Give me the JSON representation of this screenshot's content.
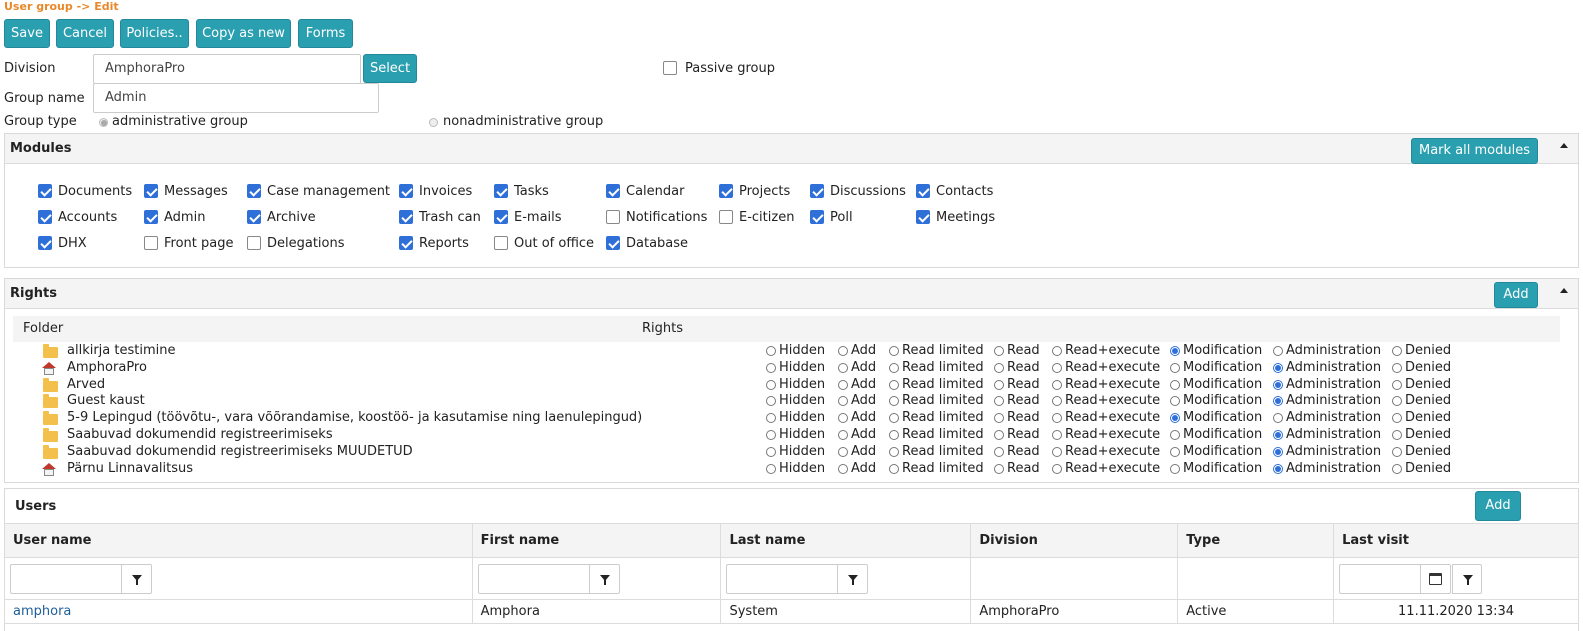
{
  "breadcrumb": "User group -> Edit",
  "toolbar": {
    "save": "Save",
    "cancel": "Cancel",
    "policies": "Policies..",
    "copy_as_new": "Copy as new",
    "forms": "Forms"
  },
  "form": {
    "division_label": "Division",
    "division_value": "AmphoraPro",
    "select_button": "Select",
    "passive_group_label": "Passive group",
    "passive_group_checked": false,
    "group_name_label": "Group name",
    "group_name_value": "Admin",
    "group_type_label": "Group type",
    "group_type_options": [
      "administrative group",
      "nonadministrative group"
    ],
    "group_type_selected": "administrative group"
  },
  "modules": {
    "title": "Modules",
    "mark_all_button": "Mark all modules",
    "items": [
      {
        "label": "Documents",
        "checked": true
      },
      {
        "label": "Messages",
        "checked": true
      },
      {
        "label": "Case management",
        "checked": true
      },
      {
        "label": "Invoices",
        "checked": true
      },
      {
        "label": "Tasks",
        "checked": true
      },
      {
        "label": "Calendar",
        "checked": true
      },
      {
        "label": "Projects",
        "checked": true
      },
      {
        "label": "Discussions",
        "checked": true
      },
      {
        "label": "Contacts",
        "checked": true
      },
      {
        "label": "Accounts",
        "checked": true
      },
      {
        "label": "Admin",
        "checked": true
      },
      {
        "label": "Archive",
        "checked": true
      },
      {
        "label": "Trash can",
        "checked": true
      },
      {
        "label": "E-mails",
        "checked": true
      },
      {
        "label": "Notifications",
        "checked": false
      },
      {
        "label": "E-citizen",
        "checked": false
      },
      {
        "label": "Poll",
        "checked": true
      },
      {
        "label": "Meetings",
        "checked": true
      },
      {
        "label": "DHX",
        "checked": true
      },
      {
        "label": "Front page",
        "checked": false
      },
      {
        "label": "Delegations",
        "checked": false
      },
      {
        "label": "Reports",
        "checked": true
      },
      {
        "label": "Out of office",
        "checked": false
      },
      {
        "label": "Database",
        "checked": true
      }
    ]
  },
  "rights": {
    "title": "Rights",
    "add_button": "Add",
    "col_folder": "Folder",
    "col_rights": "Rights",
    "options": [
      "Hidden",
      "Add",
      "Read limited",
      "Read",
      "Read+execute",
      "Modification",
      "Administration",
      "Denied"
    ],
    "rows": [
      {
        "folder": "allkirja testimine",
        "icon": "folder-icon",
        "selected": "Modification"
      },
      {
        "folder": "AmphoraPro",
        "icon": "home-icon",
        "selected": "Administration"
      },
      {
        "folder": "Arved",
        "icon": "folder-icon",
        "selected": "Administration"
      },
      {
        "folder": "Guest kaust",
        "icon": "folder-icon",
        "selected": "Administration"
      },
      {
        "folder": "5-9 Lepingud (töövõtu-, vara võõrandamise, koostöö- ja kasutamise ning laenulepingud)",
        "icon": "folder-icon",
        "selected": "Modification"
      },
      {
        "folder": "Saabuvad dokumendid registreerimiseks",
        "icon": "folder-icon",
        "selected": "Administration"
      },
      {
        "folder": "Saabuvad dokumendid registreerimiseks MUUDETUD",
        "icon": "folder-icon",
        "selected": "Administration"
      },
      {
        "folder": "Pärnu Linnavalitsus",
        "icon": "home-icon",
        "selected": "Administration"
      }
    ]
  },
  "users": {
    "title": "Users",
    "add_button": "Add",
    "columns": [
      "User name",
      "First name",
      "Last name",
      "Division",
      "Type",
      "Last visit"
    ],
    "rows": [
      {
        "user_name": "amphora",
        "first_name": "Amphora",
        "last_name": "System",
        "division": "AmphoraPro",
        "type": "Active",
        "last_visit": "11.11.2020 13:34"
      }
    ]
  }
}
